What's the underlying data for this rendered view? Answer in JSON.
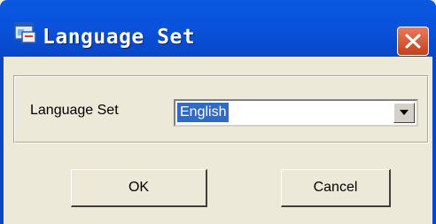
{
  "window": {
    "title": "Language Set",
    "title_icon": "app-window-icon",
    "close_icon": "close-icon"
  },
  "form": {
    "language_label": "Language Set",
    "language_select": {
      "selected_value": "English"
    }
  },
  "buttons": {
    "ok_label": "OK",
    "cancel_label": "Cancel"
  },
  "colors": {
    "titlebar": "#0a53dc",
    "dialog_background": "#ece9d8",
    "selection_highlight": "#316ac5",
    "close_button": "#d55a37"
  }
}
